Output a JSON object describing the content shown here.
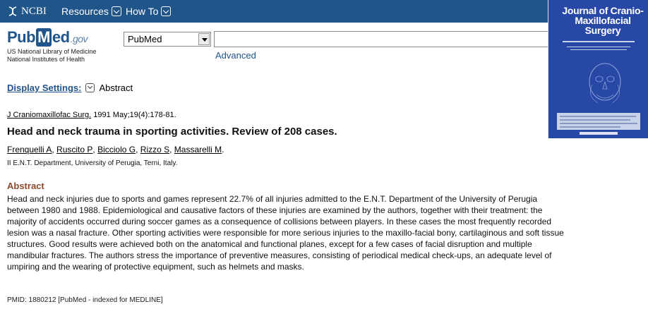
{
  "topbar": {
    "brand": "NCBI",
    "resources_label": "Resources",
    "howto_label": "How To"
  },
  "logo": {
    "pub": "Pub",
    "m": "M",
    "ed": "ed",
    "gov": ".gov",
    "line1": "US National Library of Medicine",
    "line2": "National Institutes of Health"
  },
  "search": {
    "database": "PubMed",
    "query": "",
    "advanced_label": "Advanced"
  },
  "cover": {
    "title_line1": "Journal of Cranio-",
    "title_line2": "Maxillofacial",
    "title_line3": "Surgery"
  },
  "display_settings": {
    "label": "Display Settings:",
    "value": "Abstract"
  },
  "citation": {
    "journal": "J Craniomaxillofac Surg.",
    "details": " 1991 May;19(4):178-81."
  },
  "article": {
    "title": "Head and neck trauma in sporting activities. Review of 208 cases.",
    "authors": [
      "Frenquelli A",
      "Ruscito P",
      "Bicciolo G",
      "Rizzo S",
      "Massarelli M"
    ],
    "affiliation": "II E.N.T. Department, University of Perugia, Terni, Italy."
  },
  "abstract": {
    "heading": "Abstract",
    "lines": [
      "Head and neck injuries due to sports and games represent 22.7% of all injuries admitted to the E.N.T. Department of the University of Perugia",
      "between 1980 and 1988. Epidemiological and causative factors of these injuries are examined by the authors, together with their treatment: the",
      "majority of accidents occurred during soccer games as a consequence of collisions between players. In these cases the most frequently recorded",
      "lesion was a nasal fracture. Other sporting activities were responsible for more serious injuries to the maxillo-facial bony, cartilaginous and soft tissue",
      "structures. Good results were achieved both on the anatomical and functional planes, except for a few cases of facial disruption and multiple",
      "mandibular fractures. The authors stress the importance of preventive measures, consisting of periodical medical check-ups, an adequate level of",
      "umpiring and the wearing of protective equipment, such as helmets and masks."
    ]
  },
  "pmid": "PMID: 1880212 [PubMed - indexed for MEDLINE]",
  "colors": {
    "ncbi_blue": "#20558a",
    "abstract_heading": "#8a4a2a",
    "cover_blue": "#2848a6"
  }
}
